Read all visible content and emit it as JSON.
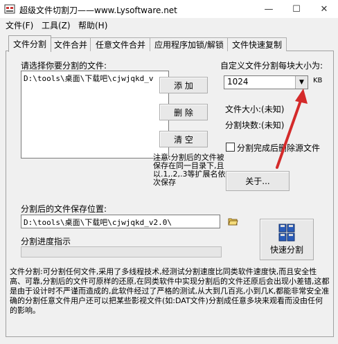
{
  "window": {
    "title": "超级文件切割刀——www.Lysoftware.net",
    "controls": {
      "minimize": "—",
      "maximize": "☐",
      "close": "✕"
    }
  },
  "menu": [
    "文件(F)",
    "工具(Z)",
    "帮助(H)"
  ],
  "tabs": [
    "文件分割",
    "文件合并",
    "任意文件合并",
    "应用程序加锁/解锁",
    "文件快速复制"
  ],
  "split_tab": {
    "select_label": "请选择你要分割的文件:",
    "files": [
      "D:\\tools\\桌面\\下载吧\\cjwjqkd_v"
    ],
    "add_button": "添 加",
    "delete_button": "删 除",
    "clear_button": "清 空",
    "custom_size_label": "自定义文件分割每块大小为:",
    "block_size": "1024",
    "block_unit": "KB",
    "file_size_label": "文件大小:(未知)",
    "block_count_label": "分割块数:(未知)",
    "delete_source_label": "分割完成后删除源文件",
    "delete_source_checked": false,
    "note_text": "注意:分割后的文件被保存在同一目录下,且以.1,.2,.3等扩展名依次保存",
    "about_button": "关于...",
    "save_location_label": "分割后的文件保存位置:",
    "save_path": "D:\\tools\\桌面\\下载吧\\cjwjqkd_v2.0\\",
    "progress_label": "分割进度指示",
    "progress": 0,
    "quick_split_button": "快速分割",
    "description": "文件分割:可分割任何文件,采用了多线程技术,经测试分割速度比同类软件速度快,而且安全性高、可靠,分割后的文件可原样的还原,在同类软件中实现分割后的文件还原后会出现小差错,这都是由于设计时不严谨而造成的,此软件经过了严格的测试,从大到几百兆,小到几K,都能非常安全准确的分割任意文件用户还可以把某些影视文件(如:DAT文件)分割成任意多块来观看而没由任何的影响。"
  },
  "colors": {
    "annotation_arrow": "#d42a2a",
    "quick_split_icon": "#2a5bb8"
  }
}
